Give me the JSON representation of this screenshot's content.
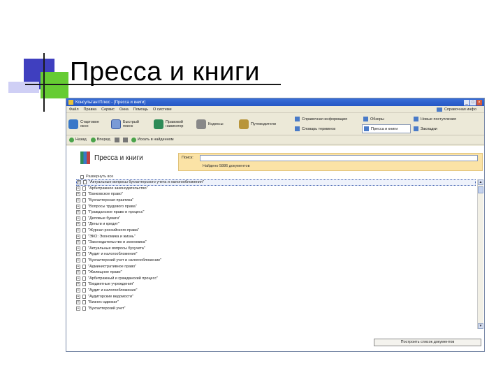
{
  "slide": {
    "title": "Пресса и книги"
  },
  "window": {
    "title": "КонсультантПлюс - [Пресса и книги]",
    "controls": [
      "_",
      "□",
      "×"
    ]
  },
  "menu": {
    "items": [
      "Файл",
      "Правка",
      "Сервис",
      "Окна",
      "Помощь",
      "О системе"
    ],
    "right_label": "Справочная инфо"
  },
  "toolbar": {
    "buttons": [
      {
        "label": "Стартовое окно",
        "icon": "home-icon"
      },
      {
        "label": "Быстрый поиск",
        "icon": "magnifier-icon"
      },
      {
        "label": "Правовой навигатор",
        "icon": "navigator-icon"
      },
      {
        "label": "Кодексы",
        "icon": "codex-icon"
      },
      {
        "label": "Путеводители",
        "icon": "guide-icon"
      }
    ],
    "right_panel": [
      {
        "label": "Справочная информация",
        "icon": "info-icon",
        "active": false
      },
      {
        "label": "Обзоры",
        "icon": "reviews-icon",
        "active": false
      },
      {
        "label": "Новые поступления",
        "icon": "new-icon",
        "active": false
      },
      {
        "label": "Словарь терминов",
        "icon": "dictionary-icon",
        "active": false
      },
      {
        "label": "Пресса и книги",
        "icon": "press-icon",
        "active": true
      },
      {
        "label": "Закладки",
        "icon": "bookmarks-icon",
        "active": false
      }
    ]
  },
  "navbar": {
    "back_label": "Назад",
    "forward_label": "Вперед",
    "extra_label": "Искать в найденном"
  },
  "content": {
    "header_title": "Пресса и книги",
    "search_label": "Поиск:",
    "search_value": "",
    "search_hint": "Найдено 5886 документов",
    "expand_all_label": "Развернуть все",
    "list_items": [
      {
        "text": "\"Актуальные вопросы бухгалтерского учета и налогообложения\"",
        "expanded": false,
        "selected": true
      },
      {
        "text": "\"Арбитражное законодательство\"",
        "expanded": false,
        "selected": false
      },
      {
        "text": "\"Банковское право\"",
        "expanded": false,
        "selected": false
      },
      {
        "text": "\"Бухгалтерская практика\"",
        "expanded": false,
        "selected": false
      },
      {
        "text": "\"Вопросы трудового права\"",
        "expanded": false,
        "selected": false
      },
      {
        "text": "\"Гражданское право и процесс\"",
        "expanded": false,
        "selected": false
      },
      {
        "text": "\"Деловые бумаги\"",
        "expanded": false,
        "selected": false
      },
      {
        "text": "\"Деньги и кредит\"",
        "expanded": false,
        "selected": false
      },
      {
        "text": "\"Журнал российского права\"",
        "expanded": false,
        "selected": false
      },
      {
        "text": "\"ЭКО: Экономика и жизнь\"",
        "expanded": false,
        "selected": false
      },
      {
        "text": "\"Законодательство и экономика\"",
        "expanded": false,
        "selected": false
      },
      {
        "text": "\"Актуальные вопросы бухучета\"",
        "expanded": false,
        "selected": false
      },
      {
        "text": "\"Аудит и налогообложение\"",
        "expanded": false,
        "selected": false
      },
      {
        "text": "\"Бухгалтерский учет и налогообложение\"",
        "expanded": false,
        "selected": false
      },
      {
        "text": "\"Административное право\"",
        "expanded": false,
        "selected": false
      },
      {
        "text": "\"Жилищное право\"",
        "expanded": false,
        "selected": false
      },
      {
        "text": "\"Арбитражный и гражданский процесс\"",
        "expanded": false,
        "selected": false
      },
      {
        "text": "\"Бюджетные учреждения\"",
        "expanded": false,
        "selected": false
      },
      {
        "text": "\"Аудит и налогообложение\"",
        "expanded": false,
        "selected": false
      },
      {
        "text": "\"Аудиторские ведомости\"",
        "expanded": false,
        "selected": false
      },
      {
        "text": "\"Бизнес-адвокат\"",
        "expanded": false,
        "selected": false
      },
      {
        "text": "\"Бухгалтерский учет\"",
        "expanded": false,
        "selected": false
      }
    ],
    "bottom_button": "Построить список документов"
  }
}
